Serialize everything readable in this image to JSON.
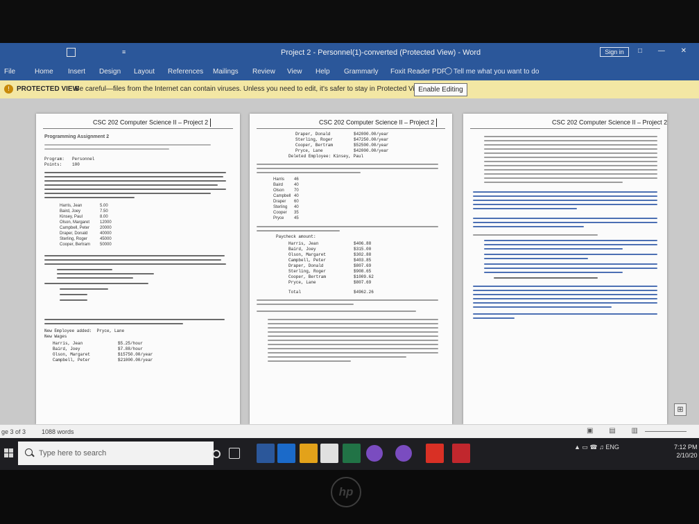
{
  "window": {
    "title": "Project 2 - Personnel(1)-converted (Protected View) - Word",
    "qat_glyph": "≡",
    "sign_in": "Sign in",
    "controls": "□ — ✕"
  },
  "ribbon": {
    "tabs": [
      "File",
      "Home",
      "Insert",
      "Design",
      "Layout",
      "References",
      "Mailings",
      "Review",
      "View",
      "Help",
      "Grammarly",
      "Foxit Reader PDF"
    ],
    "tell_me": "Tell me what you want to do"
  },
  "protected_view": {
    "label": "PROTECTED VIEW",
    "message": "Be careful—files from the Internet can contain viruses. Unless you need to edit, it's safer to stay in Protected View.",
    "button": "Enable Editing"
  },
  "pages": [
    {
      "header": "CSC 202 Computer Science II – Project 2",
      "heading": "Programming Assignment 2",
      "labels": [
        "Program:",
        "Points:"
      ],
      "label_values": [
        "Personnel",
        "100"
      ],
      "employees": [
        "Harris, Jean",
        "Baird, Joey",
        "Kinsey, Paul",
        "Olson, Margaret",
        "Campbell, Peter",
        "Draper, Donald",
        "Sterling, Roger",
        "Cooper, Bertram"
      ],
      "employee_values": [
        "5.00",
        "7.50",
        "8.00",
        "12000",
        "20000",
        "40000",
        "45000",
        "50000"
      ],
      "new_employees_header": "New Employee added:  Pryce, Lane",
      "new_wages_header": "New Wages",
      "new_wages": [
        {
          "name": "Harris, Jean",
          "value": "$5.25/hour"
        },
        {
          "name": "Baird, Joey",
          "value": "$7.88/hour"
        },
        {
          "name": "Olson, Margaret",
          "value": "$15750.00/year"
        },
        {
          "name": "Campbell, Peter",
          "value": "$21000.00/year"
        }
      ]
    },
    {
      "header": "CSC 202 Computer Science II – Project 2",
      "salaries": [
        {
          "name": "Draper, Donald",
          "value": "$42000.00/year"
        },
        {
          "name": "Sterling, Roger",
          "value": "$47250.00/year"
        },
        {
          "name": "Cooper, Bertram",
          "value": "$52500.00/year"
        },
        {
          "name": "Pryce, Lane",
          "value": "$42000.00/year"
        }
      ],
      "deleted": "Deleted Employee: Kinsey, Paul",
      "hours": [
        {
          "name": "Harris",
          "value": "46"
        },
        {
          "name": "Baird",
          "value": "40"
        },
        {
          "name": "Olson",
          "value": "70"
        },
        {
          "name": "Campbell",
          "value": "40"
        },
        {
          "name": "Draper",
          "value": "60"
        },
        {
          "name": "Sterling",
          "value": "40"
        },
        {
          "name": "Cooper",
          "value": "35"
        },
        {
          "name": "Pryce",
          "value": "45"
        }
      ],
      "paycheck_header": "Paycheck amount:",
      "paychecks": [
        {
          "name": "Harris, Jean",
          "value": "$406.88"
        },
        {
          "name": "Baird, Joey",
          "value": "$315.00"
        },
        {
          "name": "Olson, Margaret",
          "value": "$302.88"
        },
        {
          "name": "Campbell, Peter",
          "value": "$403.85"
        },
        {
          "name": "Draper, Donald",
          "value": "$807.69"
        },
        {
          "name": "Sterling, Roger",
          "value": "$908.65"
        },
        {
          "name": "Cooper, Bertram",
          "value": "$1009.62"
        },
        {
          "name": "Pryce, Lane",
          "value": "$807.69"
        }
      ],
      "total_label": "Total",
      "total_value": "$4962.26"
    },
    {
      "header": "CSC 202 Computer Science II – Project 2"
    }
  ],
  "status_bar": {
    "page": "ge 3 of 3",
    "words": "1088 words",
    "views": "▣ ▤ ▥"
  },
  "taskbar": {
    "search_placeholder": "Type here to search",
    "tray_lang": "ENG",
    "time": "7:12 PM",
    "date": "2/10/20"
  },
  "brand": "hp"
}
